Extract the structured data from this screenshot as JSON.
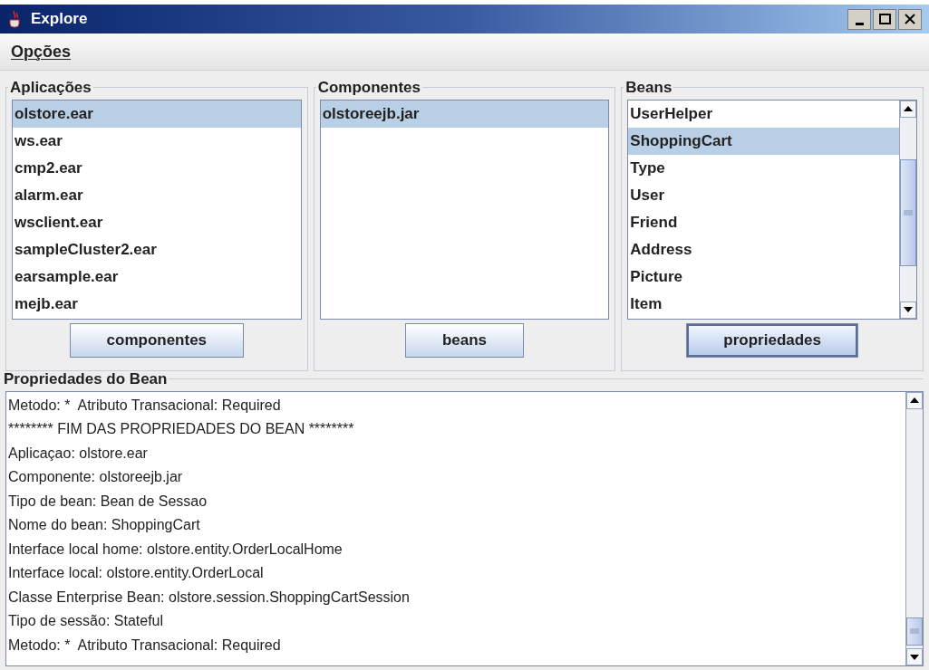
{
  "window": {
    "title": "Explore"
  },
  "menu": [
    {
      "label": "Opções"
    }
  ],
  "panels": [
    {
      "title": "Aplicações",
      "scrollbar": false,
      "items": [
        {
          "label": "olstore.ear",
          "selected": true
        },
        {
          "label": "ws.ear",
          "selected": false
        },
        {
          "label": "cmp2.ear",
          "selected": false
        },
        {
          "label": "alarm.ear",
          "selected": false
        },
        {
          "label": "wsclient.ear",
          "selected": false
        },
        {
          "label": "sampleCluster2.ear",
          "selected": false
        },
        {
          "label": "earsample.ear",
          "selected": false
        },
        {
          "label": "mejb.ear",
          "selected": false
        }
      ],
      "button": {
        "label": "componentes",
        "focused": false
      }
    },
    {
      "title": "Componentes",
      "scrollbar": false,
      "items": [
        {
          "label": "olstoreejb.jar",
          "selected": true
        }
      ],
      "button": {
        "label": "beans",
        "focused": false
      }
    },
    {
      "title": "Beans",
      "scrollbar": true,
      "items": [
        {
          "label": "UserHelper",
          "selected": false
        },
        {
          "label": "ShoppingCart",
          "selected": true
        },
        {
          "label": "Type",
          "selected": false
        },
        {
          "label": "User",
          "selected": false
        },
        {
          "label": "Friend",
          "selected": false
        },
        {
          "label": "Address",
          "selected": false
        },
        {
          "label": "Picture",
          "selected": false
        },
        {
          "label": "Item",
          "selected": false
        }
      ],
      "button": {
        "label": "propriedades",
        "focused": true
      }
    }
  ],
  "properties": {
    "title": "Propriedades do Bean",
    "lines": [
      "Metodo: *  Atributo Transacional: Required",
      "******** FIM DAS PROPRIEDADES DO BEAN ********",
      "Aplicaçao: olstore.ear",
      "Componente: olstoreejb.jar",
      "Tipo de bean: Bean de Sessao",
      "Nome do bean: ShoppingCart",
      "Interface local home: olstore.entity.OrderLocalHome",
      "Interface local: olstore.entity.OrderLocal",
      "Classe Enterprise Bean: olstore.session.ShoppingCartSession",
      "Tipo de sessão: Stateful",
      "Metodo: *  Atributo Transacional: Required"
    ]
  }
}
